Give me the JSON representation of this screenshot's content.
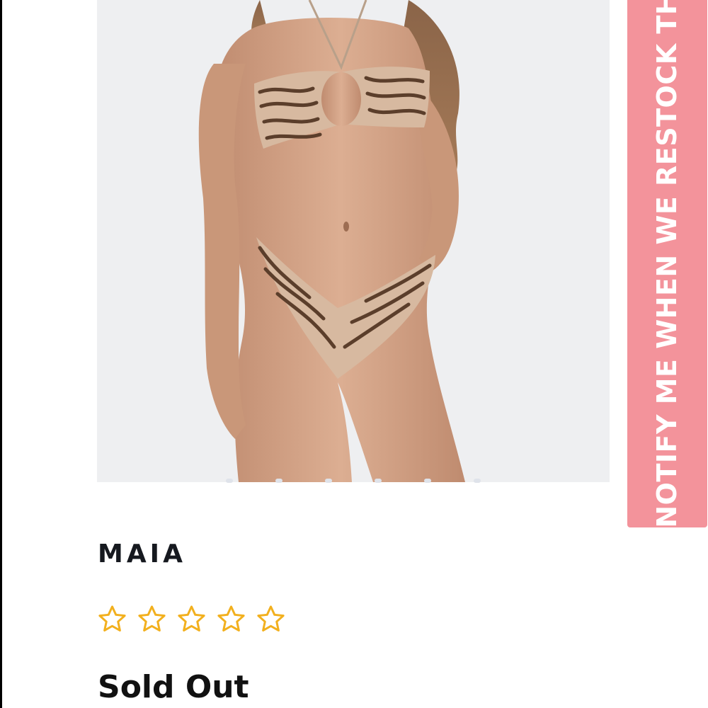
{
  "product": {
    "name": "MAIA",
    "rating": {
      "stars_filled": 0,
      "stars_total": 5,
      "star_color": "#f2b01e"
    },
    "availability": "Sold Out"
  },
  "gallery": {
    "image": "swimwear-model-photo",
    "dots": 6
  },
  "notify_tab": {
    "label": "NOTIFY ME WHEN WE RESTOCK THIS",
    "color": "#f3939b"
  }
}
